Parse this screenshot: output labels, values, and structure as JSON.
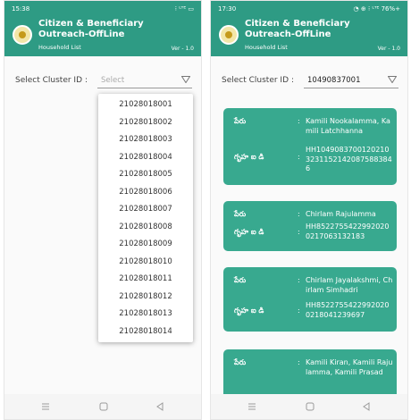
{
  "left_screen": {
    "status": {
      "time": "15:38",
      "indicators": "⁝ ᴸᵀᴱ ▭"
    },
    "app": {
      "title_line1": "Citizen & Beneficiary",
      "title_line2": "Outreach-OffLine",
      "subtitle": "Household List",
      "version": "Ver - 1.0"
    },
    "cluster": {
      "label": "Select Cluster ID",
      "colon": ":",
      "placeholder": "Select"
    },
    "dropdown_options": [
      "21028018001",
      "21028018002",
      "21028018003",
      "21028018004",
      "21028018005",
      "21028018006",
      "21028018007",
      "21028018008",
      "21028018009",
      "21028018010",
      "21028018011",
      "21028018012",
      "21028018013",
      "21028018014"
    ]
  },
  "right_screen": {
    "status": {
      "time": "17:30",
      "indicators": "◔ ⊕ ⁝ ᴸᵀᴱ 76%+"
    },
    "app": {
      "title_line1": "Citizen & Beneficiary",
      "title_line2": "Outreach-OffLine",
      "subtitle": "Household List",
      "version": "Ver - 1.0"
    },
    "cluster": {
      "label": "Select Cluster ID",
      "colon": ":",
      "value": "10490837001"
    },
    "name_key": "పేరు",
    "house_key": "గృహ ఐ డి",
    "colon": ":",
    "cards": [
      {
        "name": "Kamili Nookalamma, Kamili Latchhanna",
        "house_id": "HH104908370012021032311521420875883846"
      },
      {
        "name": "Chirlam Rajulamma",
        "house_id": "HH85227554229920200217063132183"
      },
      {
        "name": "Chirlam Jayalakshmi, Chirlam Simhadri",
        "house_id": "HH85227554229920200218041239697"
      },
      {
        "name": "Kamili Kiran, Kamili Rajulamma, Kamili Prasad",
        "house_id": ""
      }
    ]
  },
  "colors": {
    "primary": "#2e9b84",
    "card": "#38a98f"
  },
  "nav_icons": [
    "menu-icon",
    "home-icon",
    "back-icon"
  ]
}
